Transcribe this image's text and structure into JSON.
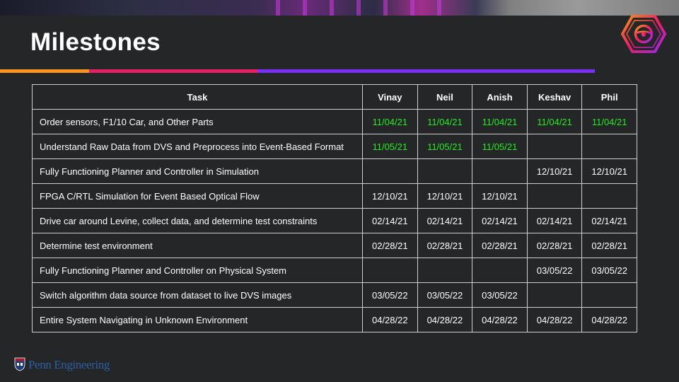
{
  "slide": {
    "title": "Milestones",
    "footer_brand": "Penn Engineering"
  },
  "colors": {
    "background": "#252627",
    "accent_orange": "#f7941d",
    "accent_pink": "#e91e63",
    "accent_purple": "#7b2ff7",
    "completed_date": "#22ee22",
    "grid": "#d0d0d0"
  },
  "icons": {
    "logo": "steering-wheel-hexagon-icon",
    "footer": "penn-shield-icon"
  },
  "table": {
    "headers": [
      "Task",
      "Vinay",
      "Neil",
      "Anish",
      "Keshav",
      "Phil"
    ],
    "rows": [
      {
        "task": "Order sensors, F1/10 Car, and Other Parts",
        "dates": [
          "11/04/21",
          "11/04/21",
          "11/04/21",
          "11/04/21",
          "11/04/21"
        ],
        "completed": [
          true,
          true,
          true,
          true,
          true
        ]
      },
      {
        "task": "Understand Raw Data from DVS and Preprocess into Event-Based Format",
        "dates": [
          "11/05/21",
          "11/05/21",
          "11/05/21",
          "",
          ""
        ],
        "completed": [
          true,
          true,
          true,
          false,
          false
        ]
      },
      {
        "task": "Fully Functioning Planner and Controller in Simulation",
        "dates": [
          "",
          "",
          "",
          "12/10/21",
          "12/10/21"
        ],
        "completed": [
          false,
          false,
          false,
          false,
          false
        ]
      },
      {
        "task": "FPGA C/RTL Simulation for Event Based Optical Flow",
        "dates": [
          "12/10/21",
          "12/10/21",
          "12/10/21",
          "",
          ""
        ],
        "completed": [
          false,
          false,
          false,
          false,
          false
        ]
      },
      {
        "task": "Drive car around Levine, collect data, and determine test constraints",
        "dates": [
          "02/14/21",
          "02/14/21",
          "02/14/21",
          "02/14/21",
          "02/14/21"
        ],
        "completed": [
          false,
          false,
          false,
          false,
          false
        ]
      },
      {
        "task": "Determine test environment",
        "dates": [
          "02/28/21",
          "02/28/21",
          "02/28/21",
          "02/28/21",
          "02/28/21"
        ],
        "completed": [
          false,
          false,
          false,
          false,
          false
        ]
      },
      {
        "task": "Fully Functioning Planner and Controller on Physical System",
        "dates": [
          "",
          "",
          "",
          "03/05/22",
          "03/05/22"
        ],
        "completed": [
          false,
          false,
          false,
          false,
          false
        ]
      },
      {
        "task": "Switch algorithm data source from dataset to live DVS images",
        "dates": [
          "03/05/22",
          "03/05/22",
          "03/05/22",
          "",
          ""
        ],
        "completed": [
          false,
          false,
          false,
          false,
          false
        ]
      },
      {
        "task": "Entire System Navigating in Unknown Environment",
        "dates": [
          "04/28/22",
          "04/28/22",
          "04/28/22",
          "04/28/22",
          "04/28/22"
        ],
        "completed": [
          false,
          false,
          false,
          false,
          false
        ]
      }
    ]
  }
}
